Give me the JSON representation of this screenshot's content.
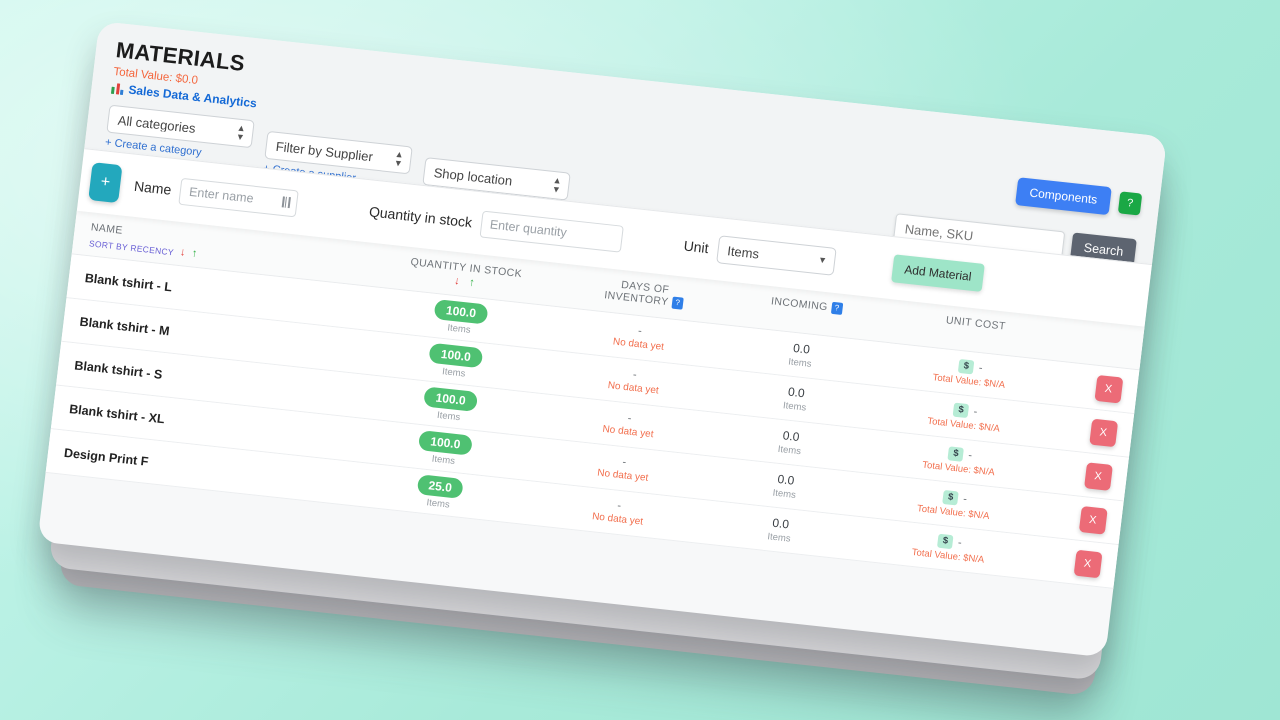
{
  "header": {
    "title": "MATERIALS",
    "total_value": "Total Value: $0.0",
    "analytics_link": "Sales Data & Analytics",
    "components_button": "Components",
    "help_button": "?"
  },
  "filters": {
    "category_selected": "All categories",
    "category_create": "+ Create a category",
    "supplier_selected": "Filter by Supplier",
    "supplier_create": "+ Create a supplier",
    "location_selected": "Shop location"
  },
  "search": {
    "placeholder": "Name, SKU",
    "value": "",
    "button": "Search"
  },
  "add_row": {
    "plus_button": "+",
    "name_label": "Name",
    "name_placeholder": "Enter name",
    "qty_label": "Quantity in stock",
    "qty_placeholder": "Enter quantity",
    "unit_label": "Unit",
    "unit_selected": "Items",
    "add_button": "Add Material"
  },
  "table": {
    "columns": {
      "name": "NAME",
      "quantity": "QUANTITY IN STOCK",
      "days": "DAYS OF INVENTORY",
      "days_line1": "DAYS OF",
      "days_line2": "INVENTORY",
      "incoming": "INCOMING",
      "unit_cost": "UNIT COST"
    },
    "sort_label": "SORT BY RECENCY",
    "sort_desc_arrow": "↓",
    "sort_asc_arrow": "↑",
    "help_badge": "?",
    "rows": [
      {
        "name": "Blank tshirt - L",
        "quantity": "100.0",
        "quantity_unit": "Items",
        "days_value": "-",
        "days_note": "No data yet",
        "incoming": "0.0",
        "incoming_unit": "Items",
        "cost_symbol": "$",
        "cost_value": "-",
        "total_value": "Total Value: $N/A",
        "delete": "X"
      },
      {
        "name": "Blank tshirt - M",
        "quantity": "100.0",
        "quantity_unit": "Items",
        "days_value": "-",
        "days_note": "No data yet",
        "incoming": "0.0",
        "incoming_unit": "Items",
        "cost_symbol": "$",
        "cost_value": "-",
        "total_value": "Total Value: $N/A",
        "delete": "X"
      },
      {
        "name": "Blank tshirt - S",
        "quantity": "100.0",
        "quantity_unit": "Items",
        "days_value": "-",
        "days_note": "No data yet",
        "incoming": "0.0",
        "incoming_unit": "Items",
        "cost_symbol": "$",
        "cost_value": "-",
        "total_value": "Total Value: $N/A",
        "delete": "X"
      },
      {
        "name": "Blank tshirt - XL",
        "quantity": "100.0",
        "quantity_unit": "Items",
        "days_value": "-",
        "days_note": "No data yet",
        "incoming": "0.0",
        "incoming_unit": "Items",
        "cost_symbol": "$",
        "cost_value": "-",
        "total_value": "Total Value: $N/A",
        "delete": "X"
      },
      {
        "name": "Design Print F",
        "quantity": "25.0",
        "quantity_unit": "Items",
        "days_value": "-",
        "days_note": "No data yet",
        "incoming": "0.0",
        "incoming_unit": "Items",
        "cost_symbol": "$",
        "cost_value": "-",
        "total_value": "Total Value: $N/A",
        "delete": "X"
      }
    ]
  },
  "colors": {
    "accent_blue": "#3d7ff4",
    "green": "#1aa845",
    "teal": "#23a8bd",
    "pill_green": "#4fc172",
    "danger": "#ec6b77",
    "orange": "#f2704f",
    "add_green": "#9ee5c8",
    "search_gray": "#5d6470"
  }
}
